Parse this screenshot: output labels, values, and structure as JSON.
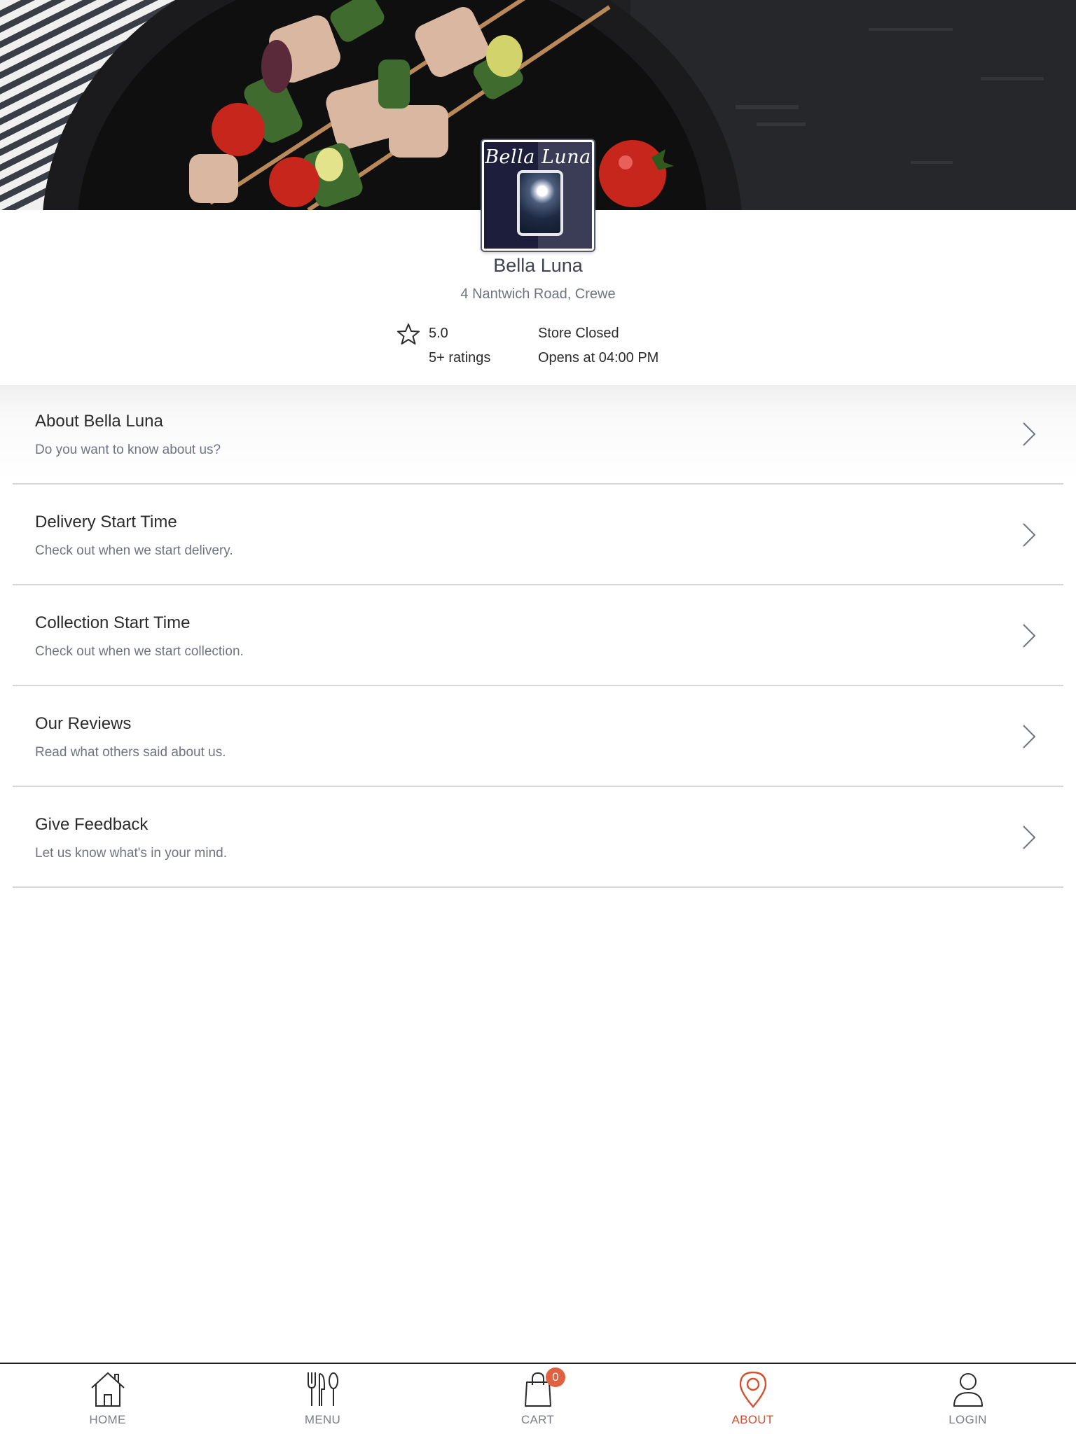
{
  "store": {
    "name": "Bella Luna",
    "logo_text": "Bella Luna",
    "address": "4 Nantwich Road, Crewe",
    "rating": "5.0",
    "rating_count": "5+ ratings",
    "status": "Store Closed",
    "opens": "Opens at 04:00 PM"
  },
  "menu_items": [
    {
      "title": "About Bella Luna",
      "subtitle": "Do you want to know about us?"
    },
    {
      "title": "Delivery Start Time",
      "subtitle": "Check out when we start delivery."
    },
    {
      "title": "Collection Start Time",
      "subtitle": "Check out when we start collection."
    },
    {
      "title": "Our Reviews",
      "subtitle": "Read what others said about us."
    },
    {
      "title": "Give Feedback",
      "subtitle": "Let us know what's in your mind."
    }
  ],
  "bottom_nav": {
    "items": [
      {
        "label": "HOME",
        "icon": "home-icon"
      },
      {
        "label": "MENU",
        "icon": "cutlery-icon"
      },
      {
        "label": "CART",
        "icon": "shopping-bag-icon"
      },
      {
        "label": "ABOUT",
        "icon": "location-pin-icon"
      },
      {
        "label": "LOGIN",
        "icon": "user-icon"
      }
    ],
    "active": "ABOUT",
    "cart_count": "0"
  },
  "colors": {
    "accent": "#d5502e",
    "badge": "#e0603f",
    "text_primary": "#2b2b2b",
    "text_secondary": "#6f7482",
    "divider": "#d7d7d9"
  }
}
